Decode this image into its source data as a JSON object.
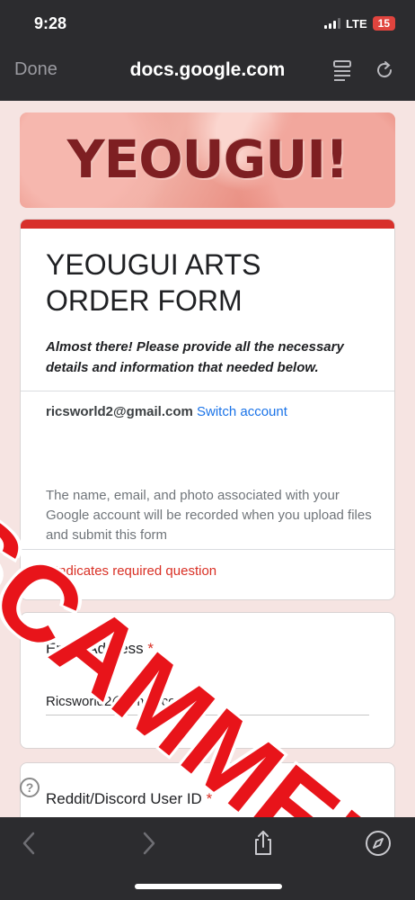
{
  "status_bar": {
    "time": "9:28",
    "network": "LTE",
    "battery": "15"
  },
  "browser": {
    "done_label": "Done",
    "url": "docs.google.com"
  },
  "banner": {
    "title": "YEOUGUI!"
  },
  "form": {
    "title": "YEOUGUI ARTS ORDER FORM",
    "description": "Almost there! Please provide all the necessary details and information that needed below.",
    "account_email": "ricsworld2@gmail.com",
    "switch_account": "Switch account",
    "info_text": "The name, email, and photo associated with your Google account will be recorded when you upload files and submit this form",
    "required_note": "* Indicates required question"
  },
  "questions": [
    {
      "label": "Email Address",
      "required_star": "*",
      "answer": "Ricsworld2@gmail.com"
    },
    {
      "label": "Reddit/Discord User ID",
      "required_star": "*"
    }
  ],
  "overlay": {
    "text": "SCAMMER"
  },
  "colors": {
    "accent_red": "#d8302b",
    "link_blue": "#1a73e8",
    "page_bg": "#f6e4e2",
    "overlay_red": "#e8141a"
  },
  "icons": [
    "signal-icon",
    "reader-icon",
    "reload-icon",
    "help-icon",
    "back-icon",
    "forward-icon",
    "share-icon",
    "compass-icon"
  ]
}
